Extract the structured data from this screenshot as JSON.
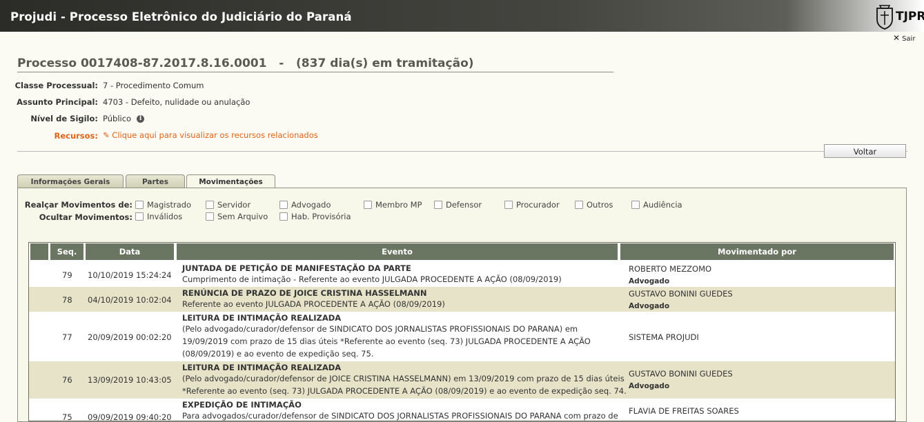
{
  "header": {
    "title": "Projudi - Processo Eletrônico do Judiciário do Paraná",
    "logo_text": "TJPR",
    "logout_label": "Sair"
  },
  "process": {
    "number_title": "Processo 0017408-87.2017.8.16.0001",
    "separator": "-",
    "days_text": "(837 dia(s) em tramitação)",
    "fields": [
      {
        "label": "Classe Processual:",
        "value": "7 - Procedimento Comum"
      },
      {
        "label": "Assunto Principal:",
        "value": "4703 - Defeito, nulidade ou anulação"
      },
      {
        "label": "Nível de Sigilo:",
        "value": "Público"
      }
    ],
    "recursos_label": "Recursos:",
    "recursos_link": "Clique aqui para visualizar os recursos relacionados"
  },
  "actions": {
    "back_label": "Voltar"
  },
  "tabs": [
    {
      "label": "Informações Gerais",
      "active": false
    },
    {
      "label": "Partes",
      "active": false
    },
    {
      "label": "Movimentações",
      "active": true
    }
  ],
  "filters": {
    "highlight_label": "Realçar Movimentos de:",
    "highlight_options": [
      "Magistrado",
      "Servidor",
      "Advogado",
      "Membro MP",
      "Defensor",
      "Procurador",
      "Outros",
      "Audiência"
    ],
    "hide_label": "Ocultar Movimentos:",
    "hide_options": [
      "Inválidos",
      "Sem Arquivo",
      "Hab. Provisória"
    ]
  },
  "table": {
    "headers": [
      "Seq.",
      "Data",
      "Evento",
      "Movimentado por"
    ],
    "rows": [
      {
        "seq": "79",
        "date": "10/10/2019 15:24:24",
        "event_title": "JUNTADA DE PETIÇÃO DE MANIFESTAÇÃO DA PARTE",
        "event_desc": [
          "Cumprimento de intimação - Referente ao evento JULGADA PROCEDENTE A AÇÃO (08/09/2019)"
        ],
        "who": "ROBERTO MEZZOMO",
        "role": "Advogado"
      },
      {
        "seq": "78",
        "date": "04/10/2019 10:02:04",
        "event_title": "RENÚNCIA DE PRAZO DE JOICE CRISTINA HASSELMANN",
        "event_desc": [
          "Referente ao evento JULGADA PROCEDENTE A AÇÃO (08/09/2019)"
        ],
        "who": "GUSTAVO BONINI GUEDES",
        "role": "Advogado"
      },
      {
        "seq": "77",
        "date": "20/09/2019 00:02:20",
        "event_title": "LEITURA DE INTIMAÇÃO REALIZADA",
        "event_desc": [
          "(Pelo advogado/curador/defensor de SINDICATO DOS JORNALISTAS PROFISSIONAIS DO PARANA) em",
          "19/09/2019 com prazo de 15 dias úteis *Referente ao evento (seq. 73) JULGADA PROCEDENTE A AÇÃO",
          "(08/09/2019) e ao evento de expedição seq. 75."
        ],
        "who": "SISTEMA PROJUDI",
        "role": ""
      },
      {
        "seq": "76",
        "date": "13/09/2019 10:43:05",
        "event_title": "LEITURA DE INTIMAÇÃO REALIZADA",
        "event_desc": [
          "(Pelo advogado/curador/defensor de JOICE CRISTINA HASSELMANN) em 13/09/2019 com prazo de 15 dias úteis",
          "*Referente ao evento (seq. 73) JULGADA PROCEDENTE A AÇÃO (08/09/2019) e ao evento de expedição seq. 74."
        ],
        "who": "GUSTAVO BONINI GUEDES",
        "role": "Advogado"
      },
      {
        "seq": "75",
        "date": "09/09/2019 09:40:20",
        "event_title": "EXPEDIÇÃO DE INTIMAÇÃO",
        "event_desc": [
          "Para advogados/curador/defensor de SINDICATO DOS JORNALISTAS PROFISSIONAIS DO PARANA com prazo de"
        ],
        "who": "FLAVIA DE FREITAS SOARES",
        "role": ""
      }
    ]
  }
}
